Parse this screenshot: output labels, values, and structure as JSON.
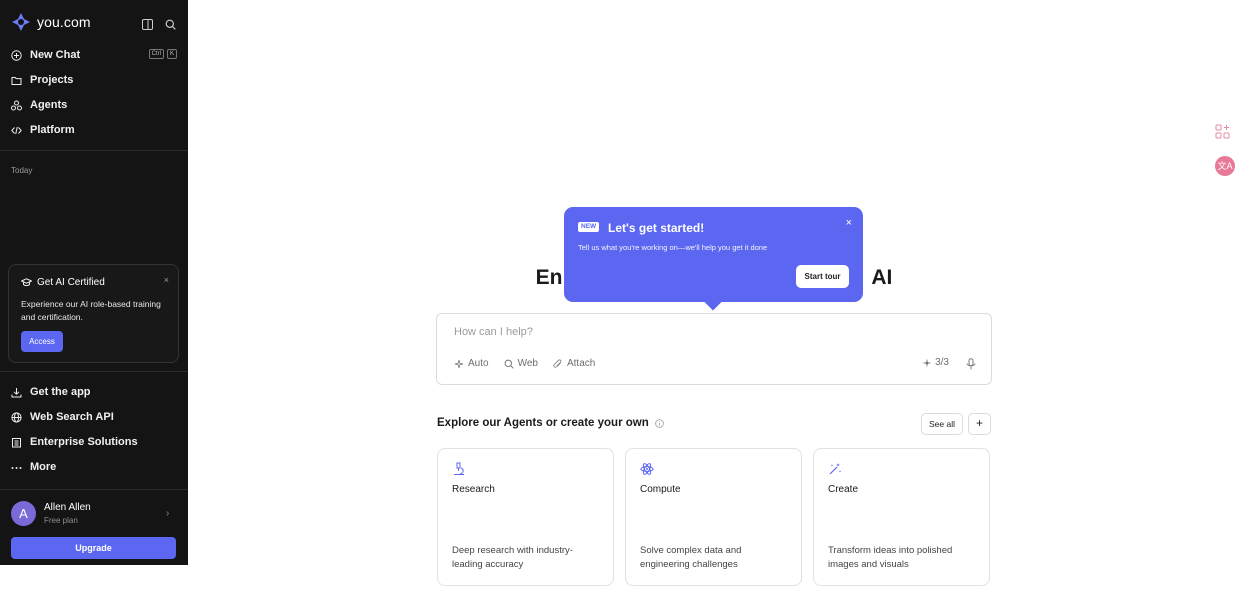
{
  "brand": {
    "name": "you.com"
  },
  "sidebar": {
    "nav": [
      {
        "label": "New Chat",
        "icon": "plus-circle-icon"
      },
      {
        "label": "Projects",
        "icon": "folder-icon"
      },
      {
        "label": "Agents",
        "icon": "agents-icon"
      },
      {
        "label": "Platform",
        "icon": "code-icon"
      }
    ],
    "shortcut": {
      "key1": "Ctrl",
      "key2": "K"
    },
    "section_today": "Today",
    "cert": {
      "title": "Get AI Certified",
      "close": "×",
      "description": "Experience our AI role-based training and certification.",
      "button": "Access"
    },
    "bottom_nav": [
      {
        "label": "Get the app",
        "icon": "download-icon"
      },
      {
        "label": "Web Search API",
        "icon": "globe-icon"
      },
      {
        "label": "Enterprise Solutions",
        "icon": "building-icon"
      },
      {
        "label": "More",
        "icon": "more-icon"
      }
    ],
    "profile": {
      "initial": "A",
      "name": "Allen Allen",
      "plan": "Free plan"
    },
    "upgrade": "Upgrade"
  },
  "headline": {
    "left": "En",
    "right": "AI"
  },
  "popover": {
    "badge": "NEW",
    "title": "Let's get started!",
    "close": "×",
    "description": "Tell us what you're working on—we'll help you get it done",
    "button": "Start tour"
  },
  "chat": {
    "placeholder": "How can I help?",
    "tools": [
      "Auto",
      "Web",
      "Attach"
    ],
    "count": "3/3"
  },
  "explore": {
    "title": "Explore our Agents or create your own",
    "see_all": "See all",
    "add": "+"
  },
  "cards": [
    {
      "name": "Research",
      "description": "Deep research with industry-leading accuracy",
      "icon": "microscope-icon"
    },
    {
      "name": "Compute",
      "description": "Solve complex data and engineering challenges",
      "icon": "atom-icon"
    },
    {
      "name": "Create",
      "description": "Transform ideas into polished images and visuals",
      "icon": "magic-wand-icon"
    }
  ],
  "right_rail": {
    "avatar_text": "文A"
  },
  "colors": {
    "accent": "#5b67f1",
    "sidebar_bg": "#141414"
  }
}
